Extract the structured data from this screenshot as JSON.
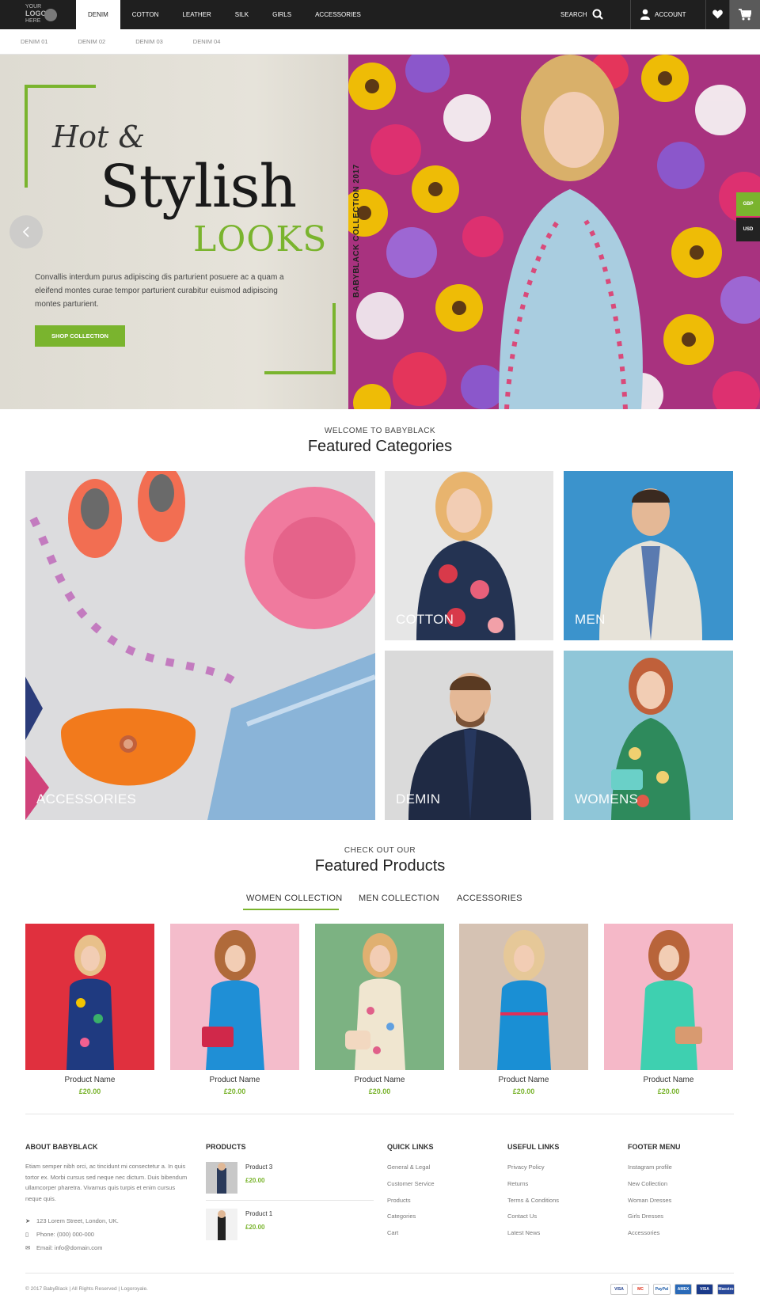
{
  "logo": {
    "line1": "YOUR",
    "line2": "LOGO",
    "line3": "HERE"
  },
  "nav": {
    "items": [
      "DENIM",
      "COTTON",
      "LEATHER",
      "SILK",
      "GIRLS",
      "ACCESSORIES"
    ],
    "search_label": "SEARCH",
    "account_label": "ACCOUNT"
  },
  "subnav": {
    "items": [
      "DENIM 01",
      "DENIM 02",
      "DENIM 03",
      "DENIM 04"
    ]
  },
  "hero": {
    "line1": "Hot &",
    "line2": "Stylish",
    "line3": "LOOKS",
    "text": "Convallis interdum purus adipiscing dis parturient posuere ac a quam a eleifend montes curae tempor parturient curabitur euismod adipiscing montes parturient.",
    "button": "SHOP COLLECTION",
    "vertical": "BABYBLACK COLLECTION 2017",
    "currency": [
      "GBP",
      "USD"
    ]
  },
  "categories": {
    "pre": "WELCOME TO BABYBLACK",
    "title": "Featured Categories",
    "items": [
      "ACCESSORIES",
      "COTTON",
      "MEN",
      "DEMIN",
      "WOMENS"
    ]
  },
  "products": {
    "pre": "CHECK OUT OUR",
    "title": "Featured Products",
    "tabs": [
      "WOMEN COLLECTION",
      "MEN COLLECTION",
      "ACCESSORIES"
    ],
    "items": [
      {
        "name": "Product Name",
        "price": "£20.00"
      },
      {
        "name": "Product Name",
        "price": "£20.00"
      },
      {
        "name": "Product Name",
        "price": "£20.00"
      },
      {
        "name": "Product Name",
        "price": "£20.00"
      },
      {
        "name": "Product Name",
        "price": "£20.00"
      }
    ]
  },
  "footer": {
    "about": {
      "title": "ABOUT BABYBLACK",
      "text": "Etiam semper nibh orci, ac tincidunt mi consectetur a. In quis tortor ex. Morbi cursus sed neque nec dictum. Duis bibendum ullamcorper pharetra. Vivamus quis turpis et enim cursus neque quis.",
      "address": "123 Lorem Street, London, UK.",
      "phone": "Phone: (000) 000-000",
      "email": "Email: info@domain.com"
    },
    "products": {
      "title": "PRODUCTS",
      "items": [
        {
          "name": "Product 3",
          "price": "£20.00"
        },
        {
          "name": "Product 1",
          "price": "£20.00"
        }
      ]
    },
    "quick_links": {
      "title": "QUICK LINKS",
      "items": [
        "General & Legal",
        "Customer Service",
        "Products",
        "Categories",
        "Cart"
      ]
    },
    "useful_links": {
      "title": "USEFUL LINKS",
      "items": [
        "Privacy Policy",
        "Returns",
        "Terms & Conditions",
        "Contact Us",
        "Latest News"
      ]
    },
    "footer_menu": {
      "title": "FOOTER MENU",
      "items": [
        "Instagram profile",
        "New Collection",
        "Woman Dresses",
        "Girls Dresses",
        "Accessories"
      ]
    },
    "copyright": "© 2017 BabyBlack | All Rights Reserved | Logoroyale.",
    "payments": [
      "VISA",
      "MC",
      "PayPal",
      "AMEX",
      "VISA",
      "Maestro"
    ]
  },
  "colors": {
    "accent": "#7ab42e",
    "topbar": "#1f1f1f"
  }
}
